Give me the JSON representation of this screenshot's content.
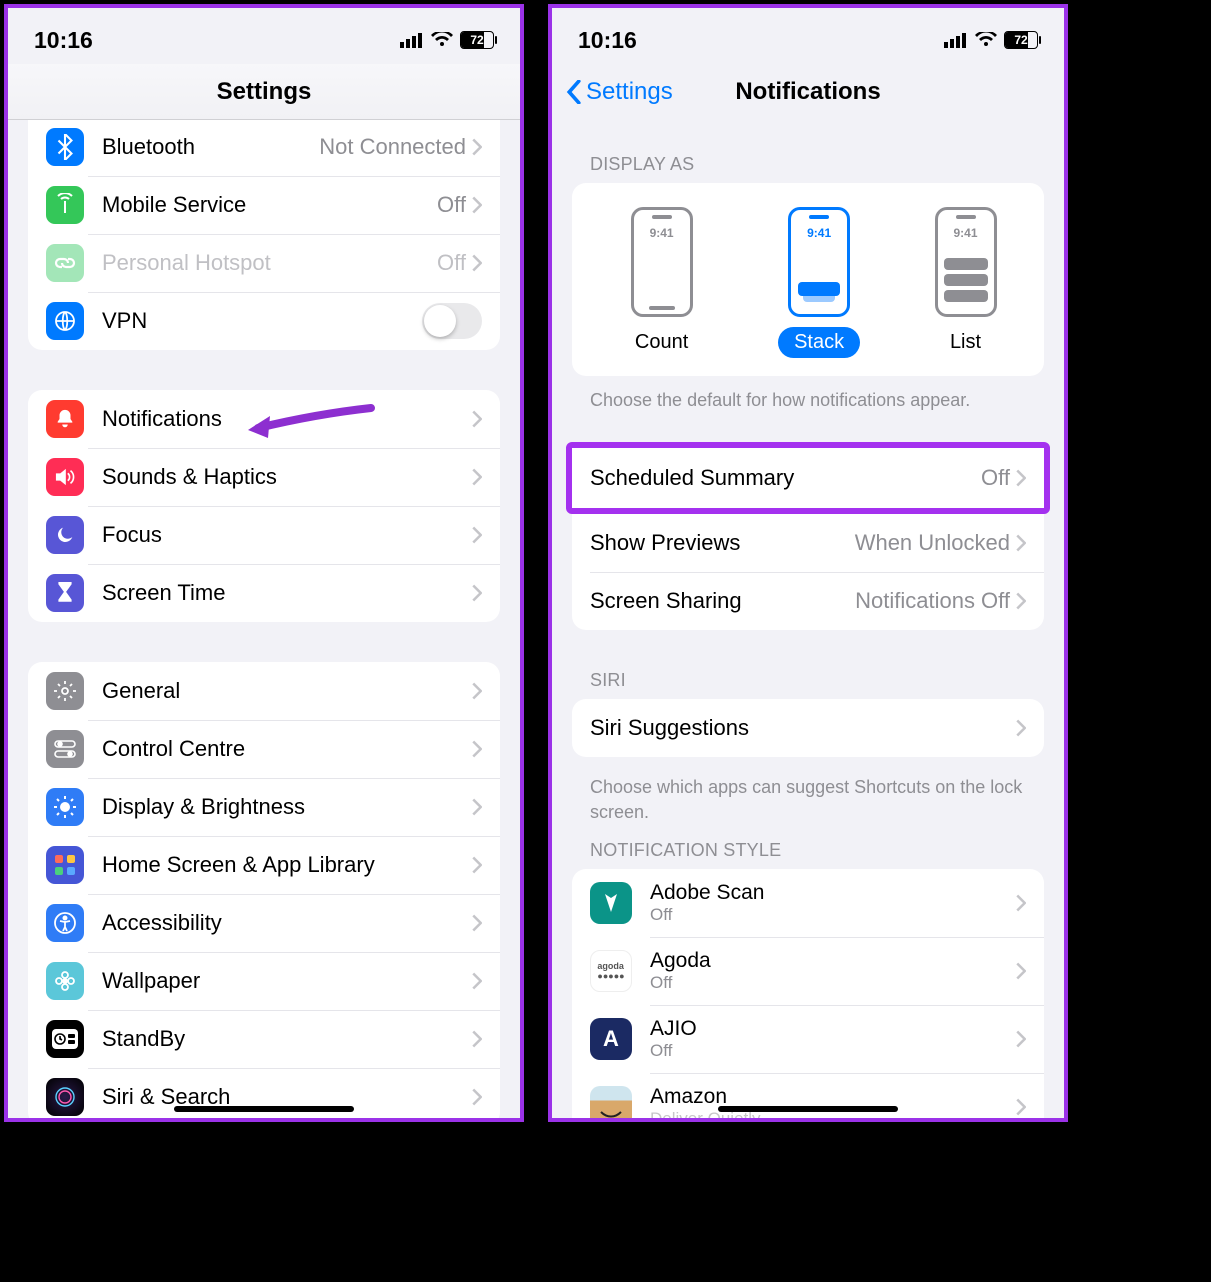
{
  "status": {
    "time": "10:16",
    "battery": "72",
    "battery_pct": 72
  },
  "left": {
    "title": "Settings",
    "group1": [
      {
        "icon": "bluetooth-icon",
        "bg": "bg-blue",
        "label": "Bluetooth",
        "value": "Not Connected",
        "chevron": true
      },
      {
        "icon": "antenna-icon",
        "bg": "bg-green",
        "label": "Mobile Service",
        "value": "Off",
        "chevron": true
      },
      {
        "icon": "link-icon",
        "bg": "bg-green2",
        "label": "Personal Hotspot",
        "value": "Off",
        "chevron": true,
        "disabled": true
      },
      {
        "icon": "globe-icon",
        "bg": "bg-blue",
        "label": "VPN",
        "toggle": true
      }
    ],
    "group2": [
      {
        "icon": "bell-icon",
        "bg": "bg-red",
        "label": "Notifications"
      },
      {
        "icon": "speaker-icon",
        "bg": "bg-red2",
        "label": "Sounds & Haptics"
      },
      {
        "icon": "moon-icon",
        "bg": "bg-purple",
        "label": "Focus"
      },
      {
        "icon": "hourglass-icon",
        "bg": "bg-purple",
        "label": "Screen Time"
      }
    ],
    "group3": [
      {
        "icon": "gear-icon",
        "bg": "bg-gray",
        "label": "General"
      },
      {
        "icon": "switches-icon",
        "bg": "bg-gray",
        "label": "Control Centre"
      },
      {
        "icon": "sun-icon",
        "bg": "bg-blue2",
        "label": "Display & Brightness"
      },
      {
        "icon": "grid-icon",
        "bg": "bg-multi",
        "label": "Home Screen & App Library"
      },
      {
        "icon": "accessibility-icon",
        "bg": "bg-blue2",
        "label": "Accessibility"
      },
      {
        "icon": "flower-icon",
        "bg": "bg-teal",
        "label": "Wallpaper"
      },
      {
        "icon": "clock-icon",
        "bg": "bg-black",
        "label": "StandBy"
      },
      {
        "icon": "siri-icon",
        "bg": "bg-black",
        "label": "Siri & Search"
      }
    ]
  },
  "right": {
    "back": "Settings",
    "title": "Notifications",
    "display_header": "DISPLAY AS",
    "display_opts": {
      "count": "Count",
      "stack": "Stack",
      "list": "List",
      "time": "9:41"
    },
    "display_footer": "Choose the default for how notifications appear.",
    "scheduled": {
      "label": "Scheduled Summary",
      "value": "Off"
    },
    "rows": [
      {
        "label": "Show Previews",
        "value": "When Unlocked"
      },
      {
        "label": "Screen Sharing",
        "value": "Notifications Off"
      }
    ],
    "siri_header": "SIRI",
    "siri_row": "Siri Suggestions",
    "siri_footer": "Choose which apps can suggest Shortcuts on the lock screen.",
    "style_header": "NOTIFICATION STYLE",
    "apps": [
      {
        "name": "Adobe Scan",
        "sub": "Off",
        "bg": "#0b9488"
      },
      {
        "name": "Agoda",
        "sub": "Off",
        "bg": "#ffffff"
      },
      {
        "name": "AJIO",
        "sub": "Off",
        "bg": "#1b2a63"
      },
      {
        "name": "Amazon",
        "sub": "Deliver Quietly",
        "bg": "#f5c26b"
      }
    ]
  }
}
